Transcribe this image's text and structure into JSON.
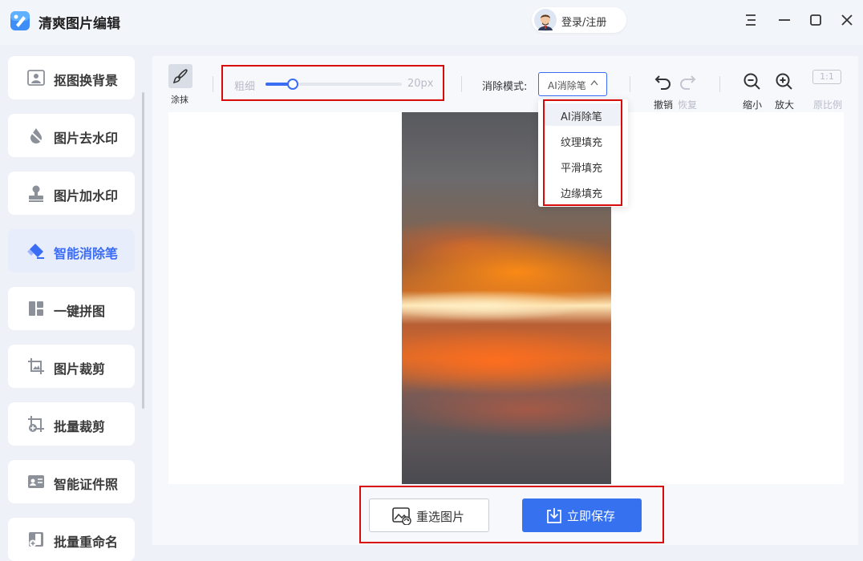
{
  "app": {
    "title": "清爽图片编辑",
    "login_label": "登录/注册"
  },
  "sidebar": {
    "items": [
      {
        "label": "抠图换背景",
        "icon": "portrait-icon"
      },
      {
        "label": "图片去水印",
        "icon": "drop-icon"
      },
      {
        "label": "图片加水印",
        "icon": "stamp-icon"
      },
      {
        "label": "智能消除笔",
        "icon": "eraser-icon",
        "active": true
      },
      {
        "label": "一键拼图",
        "icon": "collage-icon"
      },
      {
        "label": "图片裁剪",
        "icon": "crop-icon"
      },
      {
        "label": "批量裁剪",
        "icon": "batch-crop-icon"
      },
      {
        "label": "智能证件照",
        "icon": "id-photo-icon"
      },
      {
        "label": "批量重命名",
        "icon": "rename-icon"
      }
    ]
  },
  "toolbar": {
    "smear_label": "涂抹",
    "size_label": "粗细",
    "size_value": "20px",
    "size_level": 0.2,
    "mode_label": "消除模式:",
    "mode_value": "AI消除笔",
    "undo_label": "撤销",
    "redo_label": "恢复",
    "zoom_out_label": "缩小",
    "zoom_in_label": "放大",
    "ratio_badge": "1:1",
    "ratio_label": "原比例"
  },
  "mode_options": [
    "AI消除笔",
    "纹理填充",
    "平滑填充",
    "边缘填充"
  ],
  "actions": {
    "reselect_label": "重选图片",
    "save_label": "立即保存"
  },
  "colors": {
    "accent": "#3a6cf4",
    "save_button": "#3671ef",
    "annotation": "#d90a0a",
    "disabled": "#b8bcc7"
  }
}
